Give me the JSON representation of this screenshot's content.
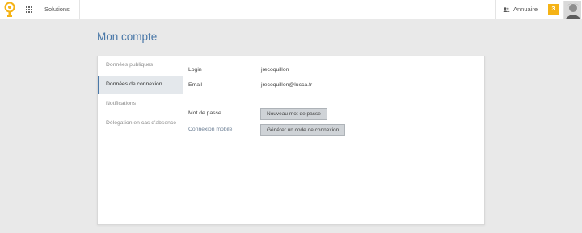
{
  "topbar": {
    "logo_icon": "lucca-lightbulb-logo",
    "apps_icon": "apps-grid-icon",
    "solutions_label": "Solutions",
    "directory_label": "Annuaire",
    "notification_count": "3",
    "accent_color": "#f5b316"
  },
  "page": {
    "title": "Mon compte",
    "title_color": "#4a78a8"
  },
  "sidebar": {
    "items": [
      {
        "label": "Données publiques",
        "active": false
      },
      {
        "label": "Données de connexion",
        "active": true
      },
      {
        "label": "Notifications",
        "active": false
      },
      {
        "label": "Délégation en cas d'absence",
        "active": false
      }
    ]
  },
  "connection": {
    "login_label": "Login",
    "login_value": "jrecoquillon",
    "email_label": "Email",
    "email_value": "jrecoquillon@lucca.fr",
    "password_label": "Mot de passe",
    "password_button": "Nouveau mot de passe",
    "mobile_label": "Connexion mobile",
    "mobile_button": "Générer un code de connexion"
  }
}
